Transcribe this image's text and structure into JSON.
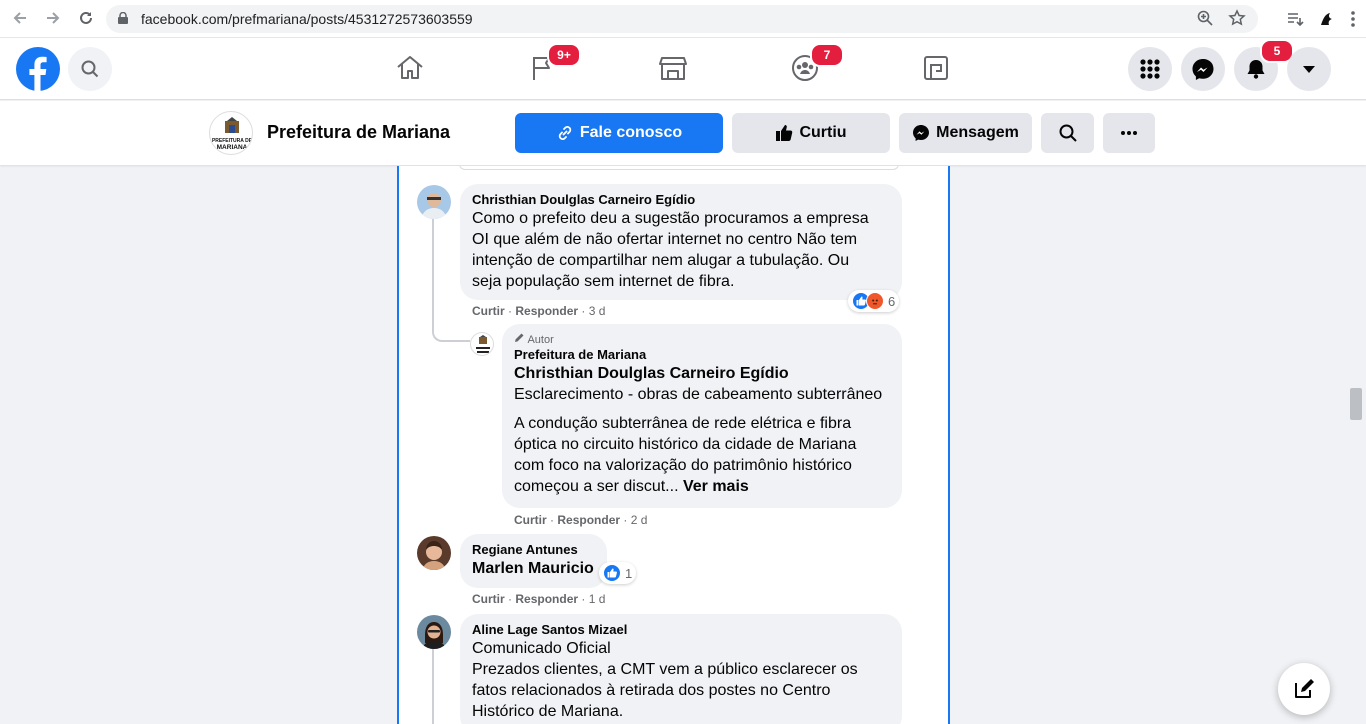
{
  "browser": {
    "url": "facebook.com/prefmariana/posts/4531272573603559"
  },
  "header": {
    "badges": {
      "pages": "9+",
      "groups": "7",
      "notifications": "5"
    }
  },
  "page": {
    "name": "Prefeitura de Mariana",
    "avatar_label": "PREFEITURA DE MARIANA",
    "buttons": {
      "contact": "Fale conosco",
      "liked": "Curtiu",
      "message": "Mensagem"
    }
  },
  "comments": [
    {
      "author": "Christhian Doulglas Carneiro Egídio",
      "lines": [
        "Como o prefeito deu a sugestão procuramos a empresa",
        "OI que além de não ofertar internet no centro Não tem",
        "intenção de compartilhar nem alugar a tubulação. Ou",
        "seja população sem internet de fibra."
      ],
      "like": "Curtir",
      "reply": "Responder",
      "time": "3 d",
      "reactions": "6"
    },
    {
      "badge": "Autor",
      "author": "Prefeitura de Mariana",
      "mention": "Christhian Doulglas Carneiro Egídio",
      "subtitle": "Esclarecimento - obras de cabeamento subterrâneo",
      "lines": [
        "A condução subterrânea de rede elétrica e fibra",
        "óptica no circuito histórico da cidade de Mariana",
        "com foco na valorização do patrimônio histórico"
      ],
      "last_line": "começou a ser discut...",
      "see_more": "Ver mais",
      "like": "Curtir",
      "reply": "Responder",
      "time": "2 d"
    },
    {
      "author": "Regiane Antunes",
      "mention": "Marlen Mauricio",
      "like": "Curtir",
      "reply": "Responder",
      "time": "1 d",
      "reactions": "1"
    },
    {
      "author": "Aline Lage Santos Mizael",
      "lines": [
        "Comunicado Oficial",
        "Prezados clientes, a CMT vem a público esclarecer os",
        "fatos relacionados à retirada dos postes no Centro",
        "Histórico de Mariana."
      ]
    }
  ],
  "separator": "·"
}
